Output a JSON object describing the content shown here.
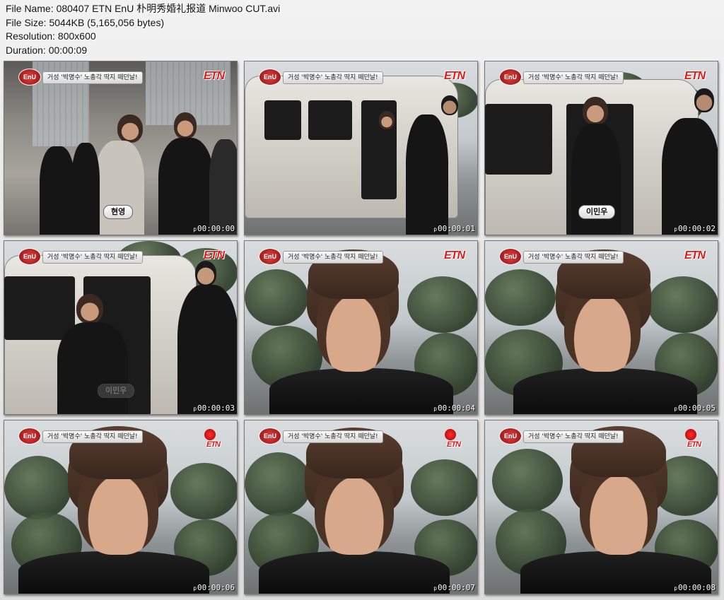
{
  "info": {
    "file_name": "File Name: 080407 ETN EnU 朴明秀婚礼报道 Minwoo CUT.avi",
    "file_size": "File Size: 5044KB (5,165,056 bytes)",
    "resolution": "Resolution: 800x600",
    "duration": "Duration: 00:00:09"
  },
  "overlay": {
    "channel_logo": "EnU",
    "caption": "거성 '박명수' 노총각 딱지 떼던날!",
    "broadcaster": "ETN",
    "timestamp_prefix": "p"
  },
  "thumbnails": [
    {
      "time": "00:00:00",
      "name_tag": "현영",
      "scene": "street"
    },
    {
      "time": "00:00:01",
      "name_tag": "",
      "scene": "van"
    },
    {
      "time": "00:00:02",
      "name_tag": "이민우",
      "scene": "van-exit"
    },
    {
      "time": "00:00:03",
      "name_tag": "이민우",
      "scene": "van-walk"
    },
    {
      "time": "00:00:04",
      "name_tag": "",
      "scene": "interview"
    },
    {
      "time": "00:00:05",
      "name_tag": "",
      "scene": "interview"
    },
    {
      "time": "00:00:06",
      "name_tag": "",
      "scene": "interview"
    },
    {
      "time": "00:00:07",
      "name_tag": "",
      "scene": "interview"
    },
    {
      "time": "00:00:08",
      "name_tag": "",
      "scene": "interview"
    }
  ],
  "colors": {
    "logo_red": "#e01818",
    "background": "#e6e6e6"
  }
}
